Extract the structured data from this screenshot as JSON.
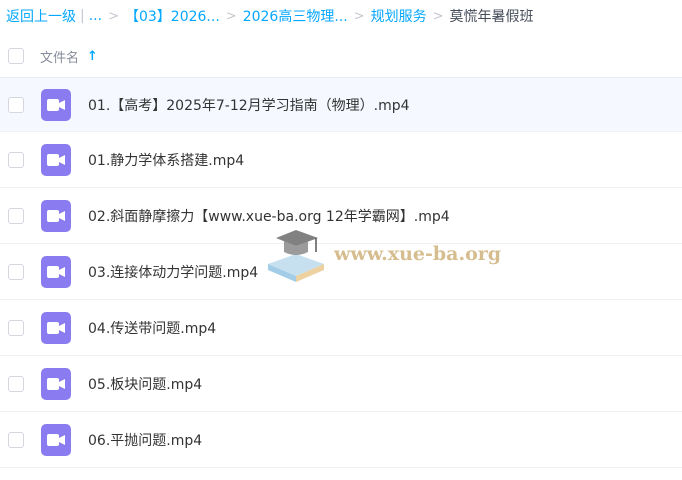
{
  "breadcrumb": {
    "back_label": "返回上一级",
    "ellipsis": "...",
    "items": [
      "【03】2026...",
      "2026高三物理...",
      "规划服务"
    ],
    "current": "莫慌年暑假班"
  },
  "header": {
    "column_label": "文件名",
    "sort_icon": "arrow-up-icon"
  },
  "files": [
    {
      "name": "01.【高考】2025年7-12月学习指南（物理）.mp4",
      "icon": "video-file-icon"
    },
    {
      "name": "01.静力学体系搭建.mp4",
      "icon": "video-file-icon"
    },
    {
      "name": "02.斜面静摩擦力【www.xue-ba.org 12年学霸网】.mp4",
      "icon": "video-file-icon"
    },
    {
      "name": "03.连接体动力学问题.mp4",
      "icon": "video-file-icon"
    },
    {
      "name": "04.传送带问题.mp4",
      "icon": "video-file-icon"
    },
    {
      "name": "05.板块问题.mp4",
      "icon": "video-file-icon"
    },
    {
      "name": "06.平抛问题.mp4",
      "icon": "video-file-icon"
    }
  ],
  "watermark": {
    "text": "www.xue-ba.org",
    "icon": "graduation-cap-book-icon"
  },
  "colors": {
    "link": "#06a7ff",
    "video_icon": "#8a7cf0",
    "selected_row": "#f5f9ff"
  }
}
